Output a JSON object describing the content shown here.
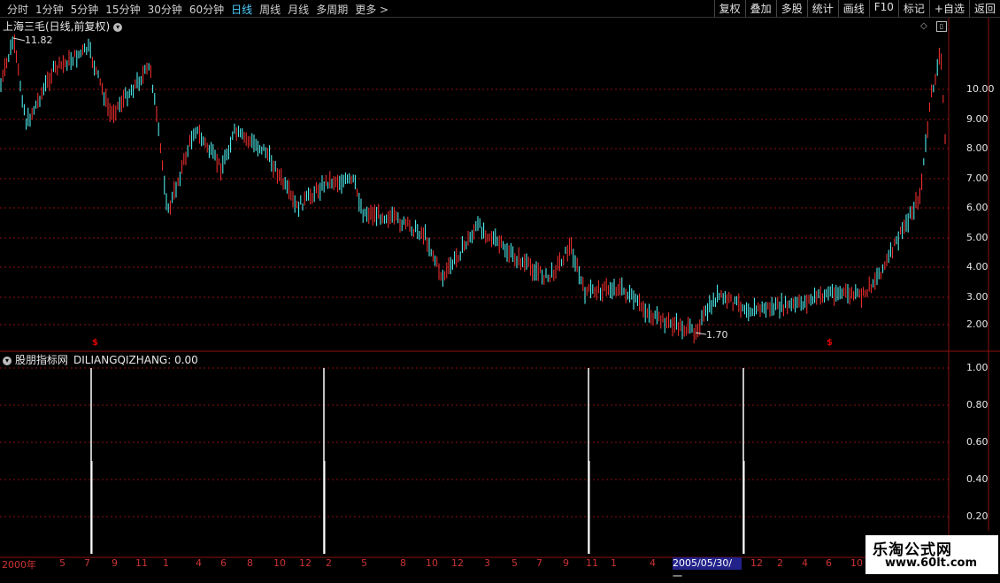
{
  "toolbar": {
    "left": [
      "分时",
      "1分钟",
      "5分钟",
      "15分钟",
      "30分钟",
      "60分钟",
      "日线",
      "周线",
      "月线",
      "多周期",
      "更多 >"
    ],
    "active_index": 6,
    "right": [
      "复权",
      "叠加",
      "多股",
      "统计",
      "画线",
      "F10",
      "标记",
      "+自选",
      "返回"
    ]
  },
  "main": {
    "title": "上海三毛(日线,前复权)",
    "high_label": "11.82",
    "low_label": "1.70",
    "y_labels": [
      "10.00",
      "9.00",
      "8.00",
      "7.00",
      "6.00",
      "5.00",
      "4.00",
      "3.00",
      "2.00"
    ]
  },
  "indicator": {
    "name": "股朋指标网",
    "value_text": "DILIANGQIZHANG: 0.00",
    "y_labels": [
      "1.00",
      "0.80",
      "0.60",
      "0.40",
      "0.20"
    ],
    "signal_bars": [
      {
        "date_index": 0,
        "value": 1.0
      },
      {
        "date_index": 1,
        "value": 1.0
      },
      {
        "date_index": 2,
        "value": 1.0
      },
      {
        "date_index": 3,
        "value": 1.0
      }
    ]
  },
  "date_axis": {
    "labels": [
      "2000年",
      "5",
      "7",
      "9",
      "11",
      "1",
      "4",
      "6",
      "8",
      "10",
      "12",
      "2",
      "5",
      "8",
      "10",
      "12",
      "3",
      "5",
      "7",
      "9",
      "11",
      "1",
      "4",
      "12",
      "2",
      "4",
      "6",
      "10"
    ],
    "selected_date": "2005/05/30/一"
  },
  "watermark": {
    "line1": "乐淘公式网",
    "line2": "www.60lt.com"
  },
  "colors": {
    "up": "#ff3232",
    "down": "#54ffff",
    "grid": "#8b1010",
    "signal": "#ffffff"
  }
}
